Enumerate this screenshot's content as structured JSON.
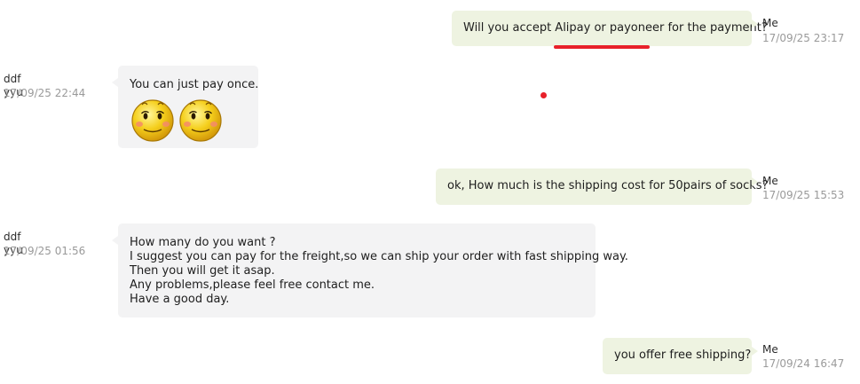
{
  "messages": [
    {
      "side": "me",
      "sender": "Me",
      "time": "17/09/25 23:17",
      "lines": [
        "Will you accept Alipay or payoneer for the payment?"
      ]
    },
    {
      "side": "them",
      "sender": "ddf yyu",
      "time": "17/09/25 22:44",
      "lines": [
        "You can just pay once."
      ],
      "emojis": [
        "smiley-face-icon",
        "smiley-face-icon"
      ]
    },
    {
      "side": "me",
      "sender": "Me",
      "time": "17/09/25 15:53",
      "lines": [
        "ok, How much is the shipping cost for 50pairs of socks?"
      ]
    },
    {
      "side": "them",
      "sender": "ddf yyu",
      "time": "17/09/25 01:56",
      "lines": [
        "How many do you want ?",
        "I suggest you can pay for the freight,so we can ship your order with fast shipping way.",
        "Then you will get it asap.",
        "Any problems,please feel free contact me.",
        "Have a good day."
      ]
    },
    {
      "side": "me",
      "sender": "Me",
      "time": "17/09/24 16:47",
      "lines": [
        "you offer free shipping?"
      ]
    }
  ],
  "colors": {
    "me_bubble": "#eef3e1",
    "them_bubble": "#f3f3f4",
    "annotation_red": "#e8202a",
    "timestamp": "#9a9a9a"
  }
}
